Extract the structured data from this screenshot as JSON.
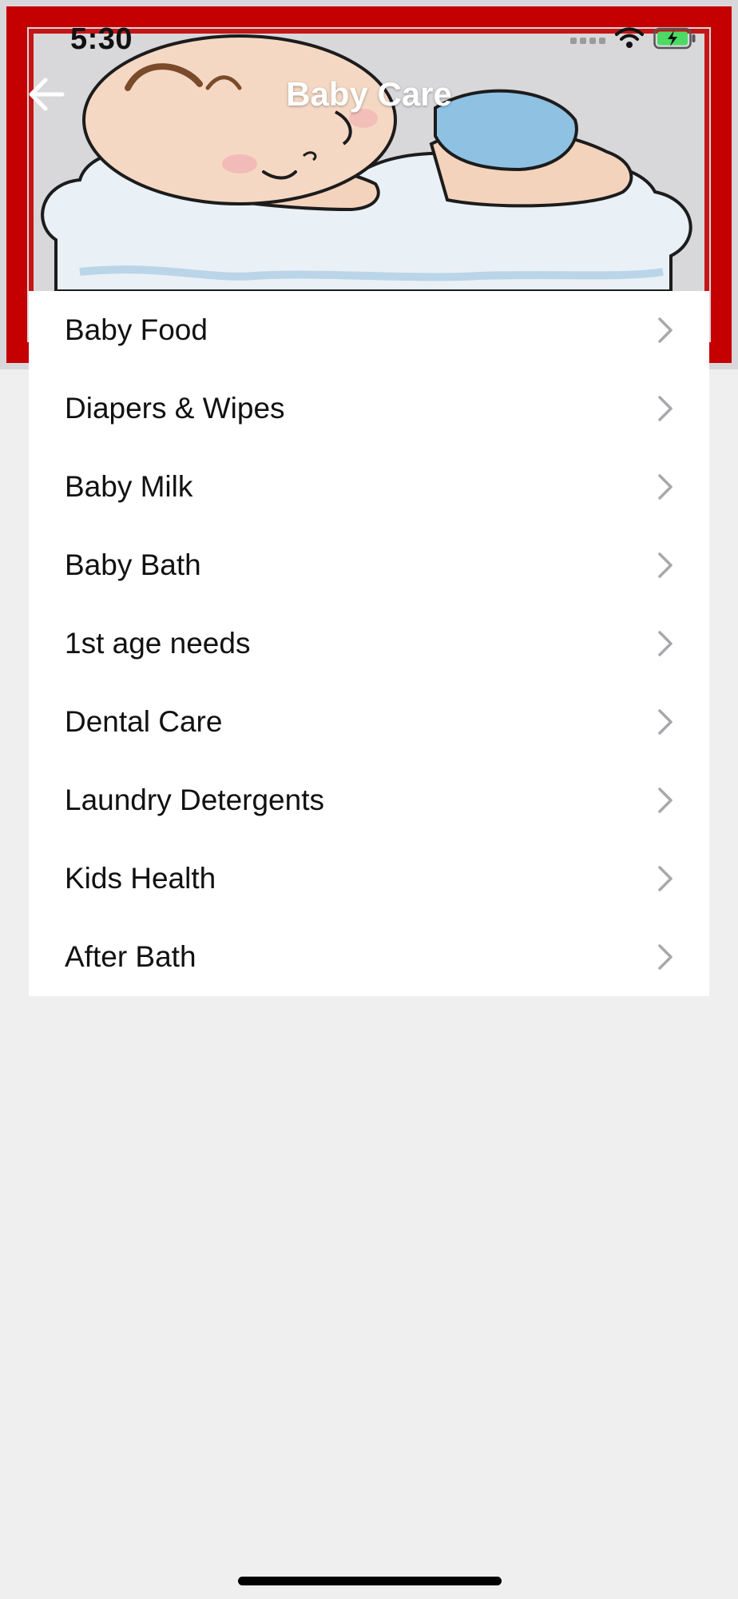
{
  "status_bar": {
    "time": "5:30",
    "icons": [
      "cellular-signal-icon",
      "wifi-icon",
      "battery-charging-icon"
    ],
    "battery_color": "#4cd964"
  },
  "header": {
    "title": "Baby Care",
    "back_icon": "arrow-left-icon",
    "banner_image": "sleeping-baby-on-cloud",
    "banner_frame_color": "#c40000"
  },
  "menu": {
    "items": [
      {
        "label": "Baby Food"
      },
      {
        "label": "Diapers & Wipes"
      },
      {
        "label": "Baby Milk"
      },
      {
        "label": "Baby Bath"
      },
      {
        "label": "1st age needs"
      },
      {
        "label": "Dental Care"
      },
      {
        "label": "Laundry Detergents"
      },
      {
        "label": "Kids Health"
      },
      {
        "label": "After Bath"
      }
    ],
    "chevron_icon": "chevron-right-icon"
  }
}
